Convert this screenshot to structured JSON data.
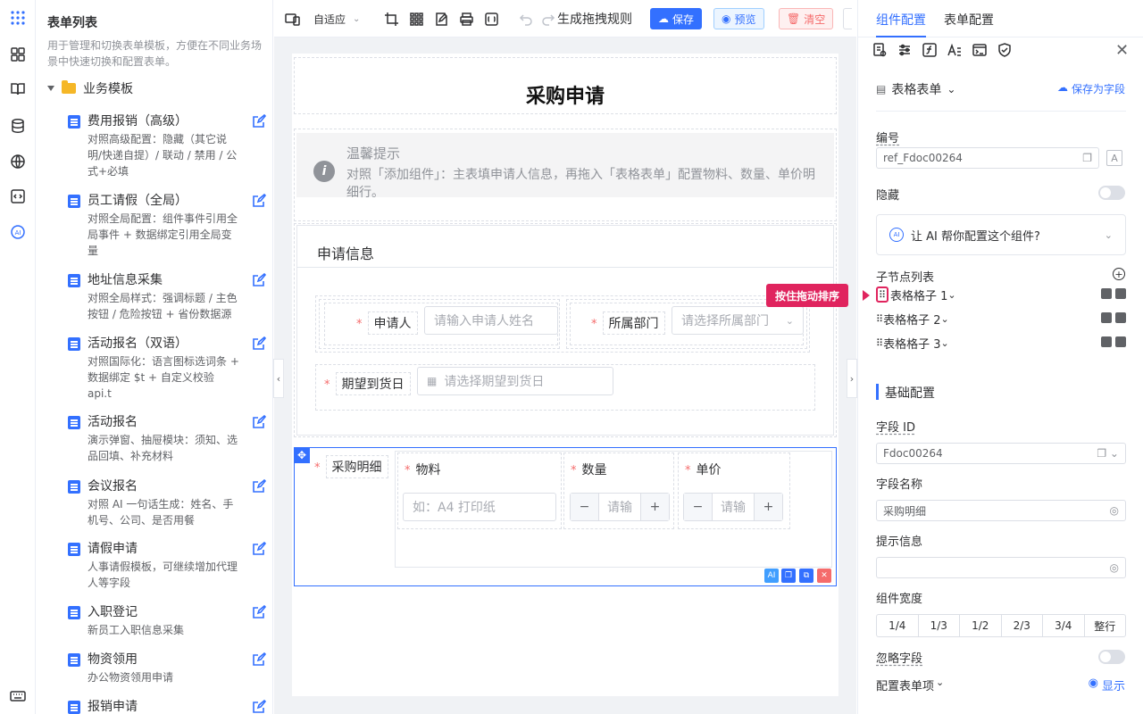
{
  "sidebar": {
    "title": "表单列表",
    "subtitle": "用于管理和切换表单模板，方便在不同业务场景中快速切换和配置表单。",
    "folder": "业务模板",
    "items": [
      {
        "name": "费用报销（高级）",
        "desc": "对照高级配置：隐藏（其它说明/快递自提）/ 联动 / 禁用 / 公式+必填"
      },
      {
        "name": "员工请假（全局）",
        "desc": "对照全局配置：组件事件引用全局事件 + 数据绑定引用全局变量"
      },
      {
        "name": "地址信息采集",
        "desc": "对照全局样式：强调标题 / 主色按钮 / 危险按钮 + 省份数据源"
      },
      {
        "name": "活动报名（双语）",
        "desc": "对照国际化：语言图标选词条 + 数据绑定 $t + 自定义校验 api.t"
      },
      {
        "name": "活动报名",
        "desc": "演示弹窗、抽屉模块：须知、选品回填、补充材料"
      },
      {
        "name": "会议报名",
        "desc": "对照 AI 一句话生成：姓名、手机号、公司、是否用餐"
      },
      {
        "name": "请假申请",
        "desc": "人事请假模板，可继续增加代理人等字段"
      },
      {
        "name": "入职登记",
        "desc": "新员工入职信息采集"
      },
      {
        "name": "物资领用",
        "desc": "办公物资领用申请"
      },
      {
        "name": "报销申请",
        "desc": ""
      }
    ]
  },
  "toolbar": {
    "adaptive": "自适应",
    "gen_rule": "生成拖拽规则",
    "save": "保存",
    "preview": "预览",
    "clear": "清空"
  },
  "form": {
    "title": "采购申请",
    "tip_title": "温馨提示",
    "tip_text": "对照「添加组件」：主表填申请人信息，再拖入「表格表单」配置物料、数量、单价明细行。",
    "section_title": "申请信息",
    "applicant_label": "申请人",
    "applicant_placeholder": "请输入申请人姓名",
    "dept_label": "所属部门",
    "dept_placeholder": "请选择所属部门",
    "date_label": "期望到货日",
    "date_placeholder": "请选择期望到货日",
    "detail_label": "采购明细",
    "col_material": "物料",
    "col_qty": "数量",
    "col_price": "单价",
    "material_placeholder": "如：A4 打印纸",
    "qty_placeholder": "请输",
    "price_placeholder": "请输",
    "ai_badge": "AI"
  },
  "panel": {
    "tab_component": "组件配置",
    "tab_form": "表单配置",
    "component_type": "表格表单",
    "save_as_field": "保存为字段",
    "label_code": "编号",
    "code_value": "ref_Fdoc00264",
    "label_hidden": "隐藏",
    "ai_help": "让 AI 帮你配置这个组件?",
    "child_list": "子节点列表",
    "drag_tip": "按住拖动排序",
    "children": [
      "表格格子 1",
      "表格格子 2",
      "表格格子 3"
    ],
    "section_basic": "基础配置",
    "label_field_id": "字段 ID",
    "field_id": "Fdoc00264",
    "label_field_name": "字段名称",
    "field_name": "采购明细",
    "label_hint": "提示信息",
    "hint": "",
    "label_width": "组件宽度",
    "widths": [
      "1/4",
      "1/3",
      "1/2",
      "2/3",
      "3/4",
      "整行"
    ],
    "label_ignore": "忽略字段",
    "label_config_items": "配置表单项",
    "show": "显示"
  },
  "colors": {
    "primary": "#3370ff",
    "danger": "#f56c6c",
    "tip_bg": "#f4f4f5"
  }
}
